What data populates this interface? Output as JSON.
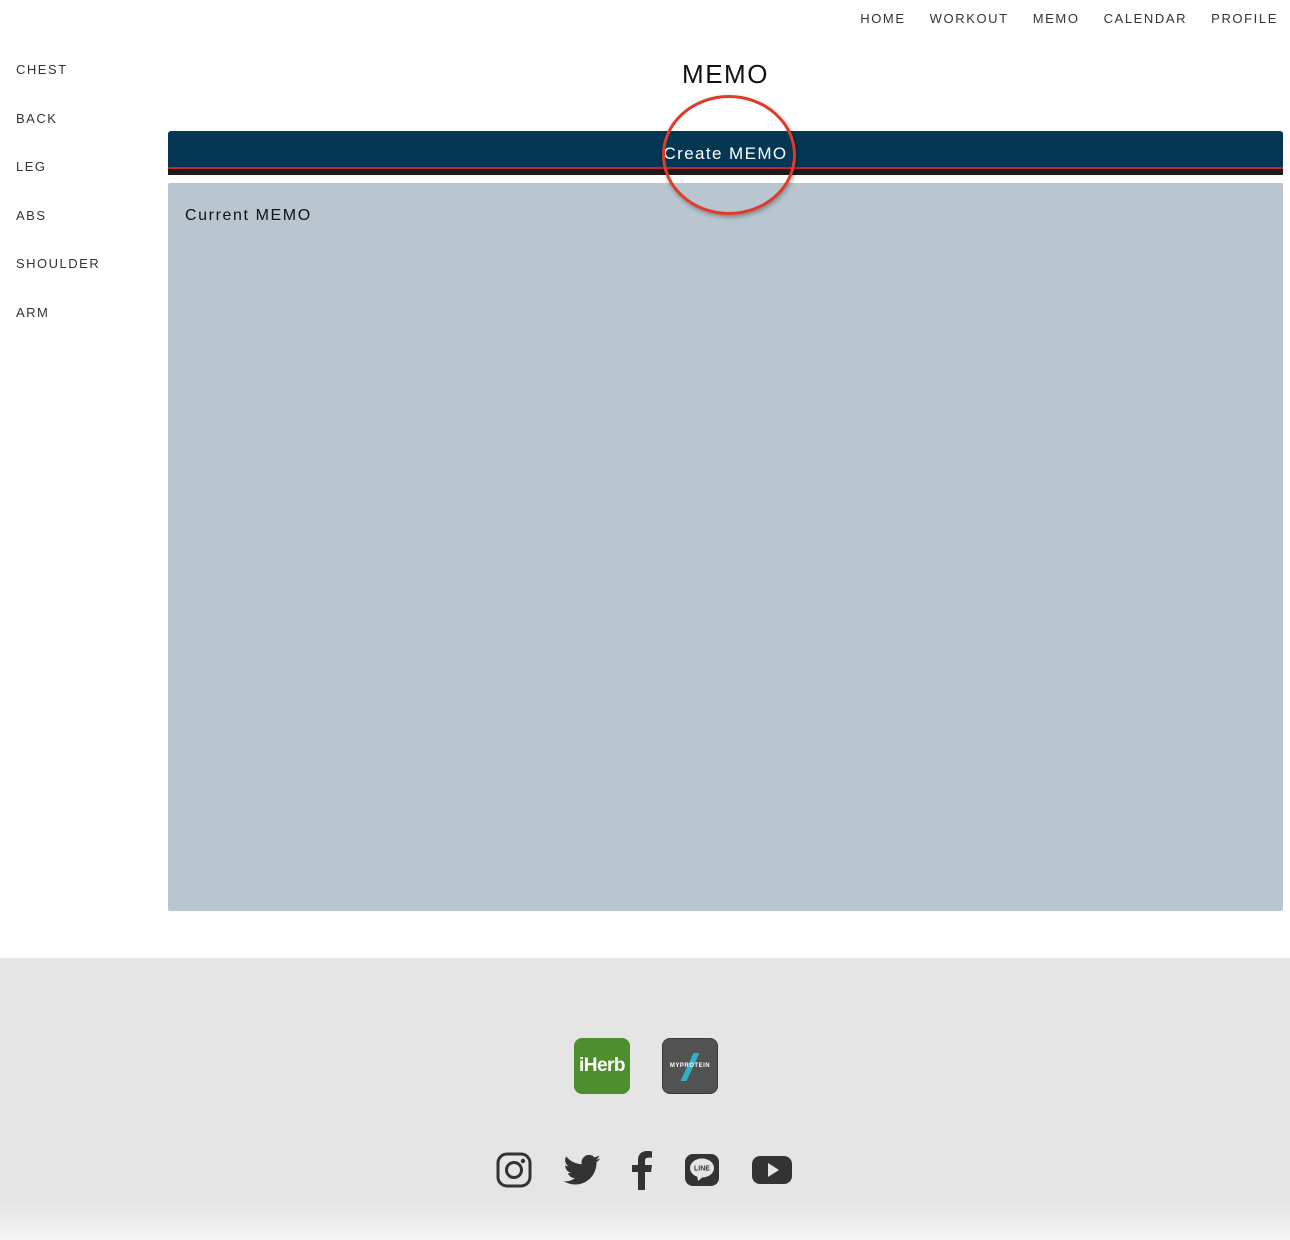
{
  "top_nav": {
    "items": [
      {
        "label": "HOME"
      },
      {
        "label": "WORKOUT"
      },
      {
        "label": "MEMO"
      },
      {
        "label": "CALENDAR"
      },
      {
        "label": "PROFILE"
      }
    ]
  },
  "sidebar": {
    "items": [
      {
        "label": "CHEST"
      },
      {
        "label": "BACK"
      },
      {
        "label": "LEG"
      },
      {
        "label": "ABS"
      },
      {
        "label": "SHOULDER"
      },
      {
        "label": "ARM"
      }
    ]
  },
  "main": {
    "title": "MEMO",
    "create_button_label": "Create MEMO",
    "current_memo_heading": "Current MEMO"
  },
  "footer": {
    "sponsors": [
      {
        "label": "iHerb",
        "icon": "iherb-logo-icon",
        "color": "#4d8f2c"
      },
      {
        "label": "MYPROTEIN",
        "icon": "myprotein-logo-icon",
        "color": "#525252"
      }
    ],
    "social_icons": [
      "instagram-icon",
      "twitter-icon",
      "facebook-icon",
      "line-icon",
      "youtube-icon"
    ]
  },
  "colors": {
    "create_button_bg": "#043754",
    "memo_panel_bg": "#b9c6cf",
    "footer_bg": "#e5e5e5",
    "annotation_circle": "#e03b2a"
  }
}
